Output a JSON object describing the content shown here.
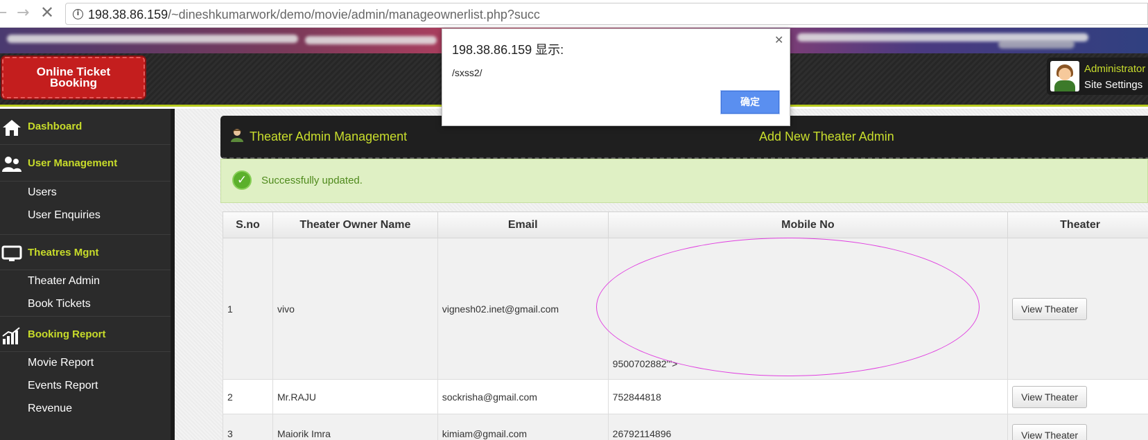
{
  "browser": {
    "url_host": "198.38.86.159",
    "url_path": "/~dineshkumarwork/demo/movie/admin/manageownerlist.php?succ"
  },
  "header": {
    "logo_text": "Online Ticket Booking",
    "profile_name": "Administrator",
    "profile_link": "Site Settings"
  },
  "sidebar": {
    "sections": [
      {
        "label": "Dashboard",
        "items": []
      },
      {
        "label": "User Management",
        "items": [
          "Users",
          "User Enquiries"
        ]
      },
      {
        "label": "Theatres Mgnt",
        "items": [
          "Theater Admin",
          "Book Tickets"
        ]
      },
      {
        "label": "Booking Report",
        "items": [
          "Movie Report",
          "Events Report",
          "Revenue"
        ]
      }
    ]
  },
  "main": {
    "title": "Theater Admin Management",
    "add_link": "Add New Theater Admin",
    "success_message": "Successfully updated.",
    "table": {
      "headers": [
        "S.no",
        "Theater Owner Name",
        "Email",
        "Mobile No",
        "Theater"
      ],
      "rows": [
        {
          "sno": "1",
          "name": "vivo",
          "email": "vignesh02.inet@gmail.com",
          "mobile": "9500702882'\">",
          "action": "View Theater"
        },
        {
          "sno": "2",
          "name": "Mr.RAJU",
          "email": "sockrisha@gmail.com",
          "mobile": "752844818",
          "action": "View Theater"
        },
        {
          "sno": "3",
          "name": "Maiorik Imra",
          "email": "kimiam@gmail.com",
          "mobile": "26792114896",
          "action": "View Theater"
        }
      ]
    }
  },
  "dialog": {
    "title": "198.38.86.159 显示:",
    "message": "/sxss2/",
    "ok_label": "确定"
  },
  "colors": {
    "accent_green": "#c9de2d",
    "dialog_button": "#5a8ff0",
    "annotation_ellipse": "#e040e0"
  }
}
